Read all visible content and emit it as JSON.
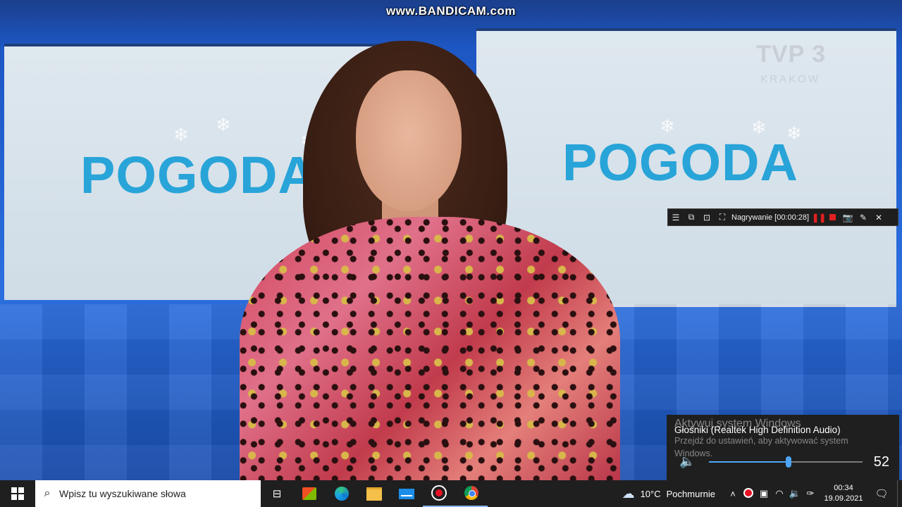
{
  "watermarks": {
    "bandicam": "www.BANDICAM.com",
    "channel": "TVP 3",
    "channel_sub": "KRAKÓW",
    "activation_title": "Aktywuj system Windows",
    "activation_text": "Przejdź do ustawień, aby aktywować system Windows."
  },
  "video": {
    "screen_left_text": "POGODA",
    "screen_right_text": "POGODA"
  },
  "recorder": {
    "status_label": "Nagrywanie [00:00:28]",
    "icons": [
      "menu-icon",
      "window-icon",
      "region-icon",
      "crop-icon",
      "pause-icon",
      "stop-icon",
      "camera-icon",
      "pencil-icon",
      "close-icon"
    ]
  },
  "volume": {
    "device_name": "Głośniki (Realtek High Definition Audio)",
    "level": 52,
    "level_text": "52",
    "accent": "#4ea5f5"
  },
  "taskbar": {
    "search_placeholder": "Wpisz tu wyszukiwane słowa",
    "pinned": [
      "task-view-icon",
      "store-icon",
      "edge-icon",
      "file-explorer-icon",
      "mail-icon",
      "recorder-app-icon",
      "chrome-icon"
    ],
    "weather_temp": "10°C",
    "weather_text": "Pochmurnie",
    "time": "00:34",
    "date": "19.09.2021"
  }
}
